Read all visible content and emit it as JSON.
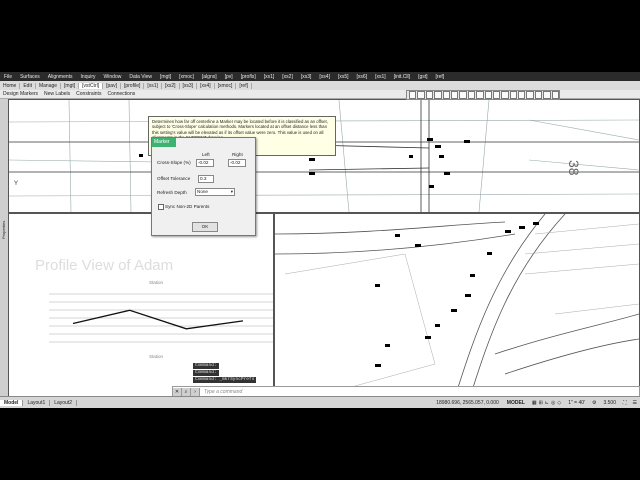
{
  "menubar": {
    "items": [
      "File",
      "Surfaces",
      "Alignments",
      "Inquiry",
      "Window",
      "Data View",
      "[mgt]",
      "[xmoc]",
      "[algns]",
      "[pv]",
      "[profls]",
      "[xs1]",
      "[xs2]",
      "[xs3]",
      "[xs4]",
      "[xs5]",
      "[xs6]",
      "[xs1]",
      "[init.Cll]",
      "[gst]",
      "[ref]"
    ]
  },
  "tabs": {
    "items": [
      "Home",
      "Edit",
      "Manage",
      "[mgt]",
      "[vstCtrl]",
      "[pav]",
      "[profile]",
      "[xs1]",
      "[xs2]",
      "[xs3]",
      "[xs4]",
      "[xmoc]",
      "[ref]"
    ],
    "active_index": 4
  },
  "ribbon": {
    "items": [
      "Design Markers",
      "New Labels",
      "Constraints",
      "Connections"
    ]
  },
  "side_panel": {
    "label": "Properties"
  },
  "viewports": {
    "bottom_left": {
      "title": "Profile View of Adam",
      "station_label_top": "Station",
      "station_label_bottom": "Station",
      "profile_line_values": [
        0.35,
        0.6,
        0.25,
        0.4
      ]
    },
    "top_axis_label": "Y",
    "station_text": "38"
  },
  "tooltip": {
    "text": "Determines how far off centerline a Marker may be located before it is classified as an offset, subject to 'Cross-Slope' calculation methods. Markers located at an offset distance less than this setting's value will be elevated as if its offset value were zero. This value is used on all alignments in the CURRENT drawing"
  },
  "dialog": {
    "title": "Marker",
    "col_left": "Left",
    "col_right": "Right",
    "cross_slope_label": "Cross-Slope (%)",
    "cross_slope_left": "-0.02",
    "cross_slope_right": "-0.02",
    "offset_tolerance_label": "Offset Tolerance",
    "offset_tolerance_value": "0.3",
    "refresh_depth_label": "Refresh Depth",
    "refresh_depth_value": "None",
    "sync_label": "Sync Non-2D Parents",
    "sync_checked": false,
    "ok_label": "OK"
  },
  "command": {
    "history": [
      "Command:",
      "Command:",
      "Command: _mkrSyncPrefs"
    ],
    "placeholder": "Type a command"
  },
  "statusbar": {
    "layout_tabs": [
      "Model",
      "Layout1",
      "Layout2"
    ],
    "active_tab": 0,
    "coordinates": "18980.696, 2565.057, 0.000",
    "space": "MODEL",
    "scale": "1\" = 40'",
    "zoom": "3.500"
  }
}
